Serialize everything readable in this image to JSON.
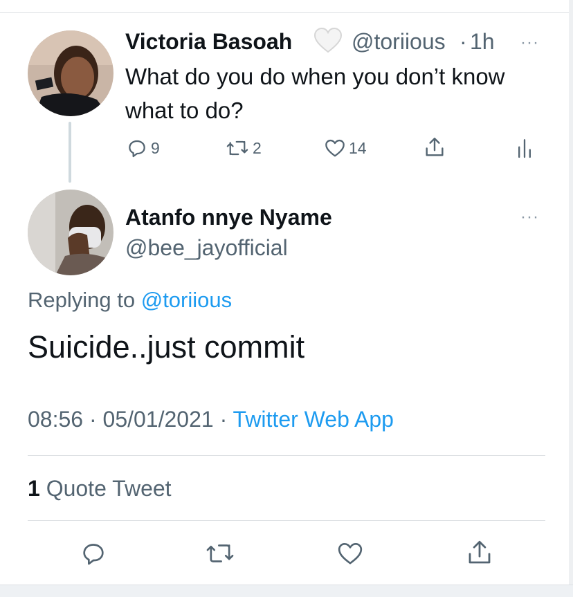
{
  "parent_tweet": {
    "display_name": "Victoria Basoah",
    "name_emoji": "🤍",
    "handle": "@toriious",
    "separator": "·",
    "time_ago": "1h",
    "more": "···",
    "text": "What do you do when you don’t know what to do?",
    "stats": {
      "replies": "9",
      "retweets": "2",
      "likes": "14"
    },
    "icons": [
      "reply-icon",
      "retweet-icon",
      "like-icon",
      "share-icon",
      "analytics-icon"
    ]
  },
  "reply_tweet": {
    "display_name": "Atanfo nnye Nyame",
    "handle": "@bee_jayofficial",
    "more": "···",
    "replying_to_label": "Replying to",
    "replying_to_handle": "@toriious",
    "text": "Suicide..just commit",
    "time": "08:56",
    "separator": "·",
    "date": "05/01/2021",
    "source": "Twitter Web App",
    "quote_count": "1",
    "quote_label": "Quote Tweet",
    "icons": [
      "reply-icon",
      "retweet-icon",
      "like-icon",
      "share-icon"
    ]
  },
  "colors": {
    "accent": "#1d9bf0",
    "text_primary": "#0f1419",
    "text_secondary": "#536471",
    "divider": "#dcdfe3"
  }
}
